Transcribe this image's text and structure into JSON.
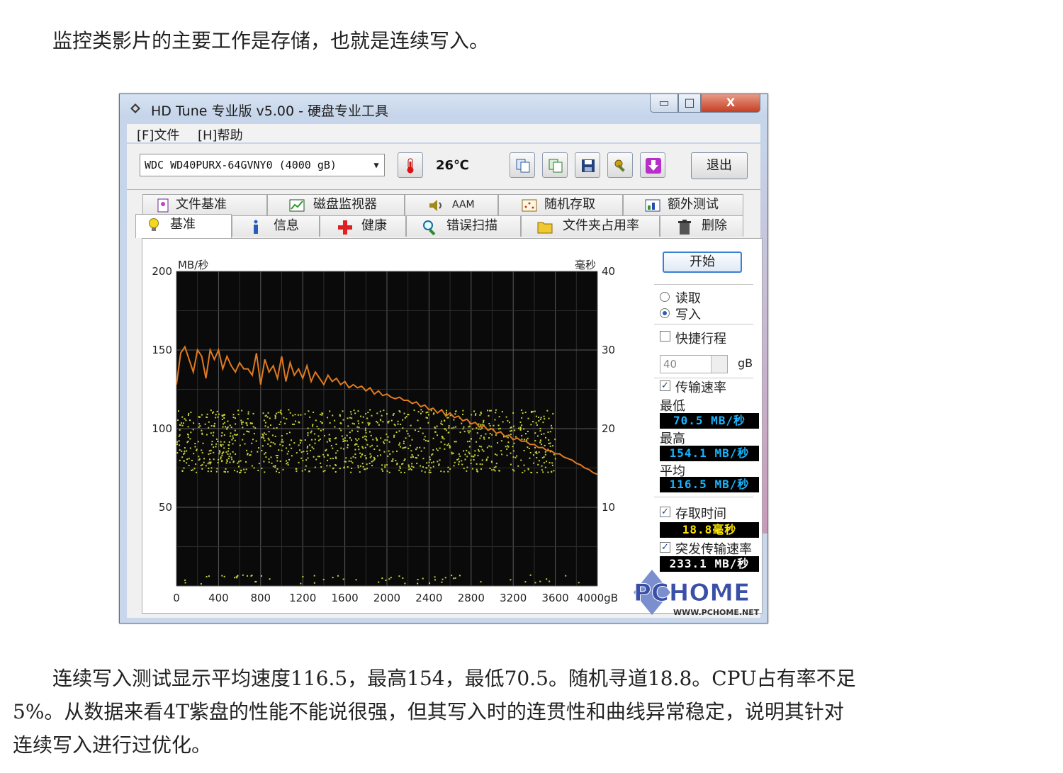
{
  "article": {
    "intro": "监控类影片的主要工作是存储，也就是连续写入。",
    "conclusion_lines": [
      "连续写入测试显示平均速度116.5，最高154，最低70.5。随机寻道18.8。CPU占有率不足",
      "5%。从数据来看4T紫盘的性能不能说很强，但其写入时的连贯性和曲线异常稳定，说明其针对",
      "连续写入进行过优化。"
    ]
  },
  "window": {
    "title": "HD Tune 专业版 v5.00 - 硬盘专业工具",
    "controls": {
      "minimize": "▭",
      "maximize": "□",
      "close": "X"
    }
  },
  "menu": [
    "[F]文件",
    "[H]帮助"
  ],
  "toolbar": {
    "drive": "WDC     WD40PURX-64GVNY0 (4000 gB)",
    "temperature": "26℃",
    "exit_label": "退出"
  },
  "tabs": {
    "row1": [
      "文件基准",
      "磁盘监视器",
      "AAM",
      "随机存取",
      "额外测试"
    ],
    "row2": [
      "基准",
      "信息",
      "健康",
      "错误扫描",
      "文件夹占用率",
      "删除"
    ],
    "active": "基准"
  },
  "side": {
    "start_label": "开始",
    "read_label": "读取",
    "write_label": "写入",
    "mode_selected": "写入",
    "short_stroke_label": "快捷行程",
    "short_stroke_checked": false,
    "short_stroke_value": "40",
    "short_stroke_unit": "gB",
    "transfer_rate_label": "传输速率",
    "transfer_rate_checked": true,
    "min_label": "最低",
    "min_value": "70.5 MB/秒",
    "max_label": "最高",
    "max_value": "154.1 MB/秒",
    "avg_label": "平均",
    "avg_value": "116.5 MB/秒",
    "access_time_label": "存取时间",
    "access_time_checked": true,
    "access_time_value": "18.8毫秒",
    "burst_rate_label": "突发传输速率",
    "burst_rate_checked": true,
    "burst_rate_value": "233.1 MB/秒"
  },
  "watermark": {
    "brand": "PCHOME",
    "url": "WWW.PCHOME.NET"
  },
  "colors": {
    "plot_bg": "#0a0a0a",
    "curve": "#e07a20",
    "dots": "#c8d23a",
    "readout_blue": "#19b4ff",
    "readout_yellow": "#ffe600"
  },
  "chart_data": {
    "type": "line",
    "title": "",
    "xlabel": "gB",
    "ylabel": "MB/秒",
    "y2label": "毫秒",
    "xlim": [
      0,
      4000
    ],
    "ylim": [
      0,
      200
    ],
    "y2lim": [
      0,
      40
    ],
    "x_ticks": [
      "0",
      "400",
      "800",
      "1200",
      "1600",
      "2000",
      "2400",
      "2800",
      "3200",
      "3600",
      "4000gB"
    ],
    "y_ticks": [
      "200",
      "150",
      "100",
      "50"
    ],
    "y2_ticks": [
      "40",
      "30",
      "20",
      "10"
    ],
    "grid": true,
    "series": [
      {
        "name": "传输速率",
        "x": [
          0,
          40,
          80,
          120,
          160,
          200,
          240,
          280,
          320,
          360,
          400,
          440,
          480,
          520,
          560,
          600,
          640,
          680,
          720,
          760,
          800,
          840,
          880,
          920,
          960,
          1000,
          1040,
          1080,
          1120,
          1160,
          1200,
          1240,
          1280,
          1320,
          1360,
          1400,
          1440,
          1480,
          1520,
          1560,
          1600,
          1640,
          1680,
          1720,
          1760,
          1800,
          1840,
          1880,
          1920,
          1960,
          2000,
          2040,
          2080,
          2120,
          2160,
          2200,
          2240,
          2280,
          2320,
          2360,
          2400,
          2440,
          2480,
          2520,
          2560,
          2600,
          2640,
          2680,
          2720,
          2760,
          2800,
          2840,
          2880,
          2920,
          2960,
          3000,
          3040,
          3080,
          3120,
          3160,
          3200,
          3240,
          3280,
          3320,
          3360,
          3400,
          3440,
          3480,
          3520,
          3560,
          3600,
          3640,
          3680,
          3720,
          3760,
          3800,
          3840,
          3880,
          3920,
          3960,
          4000
        ],
        "values": [
          128,
          148,
          152,
          144,
          136,
          150,
          146,
          132,
          150,
          144,
          150,
          138,
          146,
          140,
          136,
          142,
          138,
          138,
          134,
          148,
          128,
          144,
          136,
          140,
          132,
          146,
          130,
          142,
          134,
          138,
          132,
          140,
          130,
          136,
          132,
          128,
          134,
          130,
          132,
          128,
          130,
          126,
          128,
          126,
          127,
          124,
          126,
          122,
          124,
          121,
          122,
          120,
          119,
          120,
          118,
          118,
          116,
          117,
          114,
          115,
          112,
          113,
          110,
          112,
          108,
          110,
          107,
          108,
          105,
          106,
          103,
          104,
          101,
          102,
          99,
          100,
          97,
          98,
          95,
          96,
          93,
          94,
          92,
          92,
          90,
          90,
          88,
          88,
          86,
          86,
          84,
          84,
          82,
          81,
          80,
          78,
          77,
          75,
          74,
          72,
          71
        ]
      },
      {
        "name": "存取时间",
        "axis": "right",
        "type": "scatter",
        "point_count": 1100,
        "y_range_ms": [
          14.5,
          22.5
        ]
      }
    ]
  }
}
